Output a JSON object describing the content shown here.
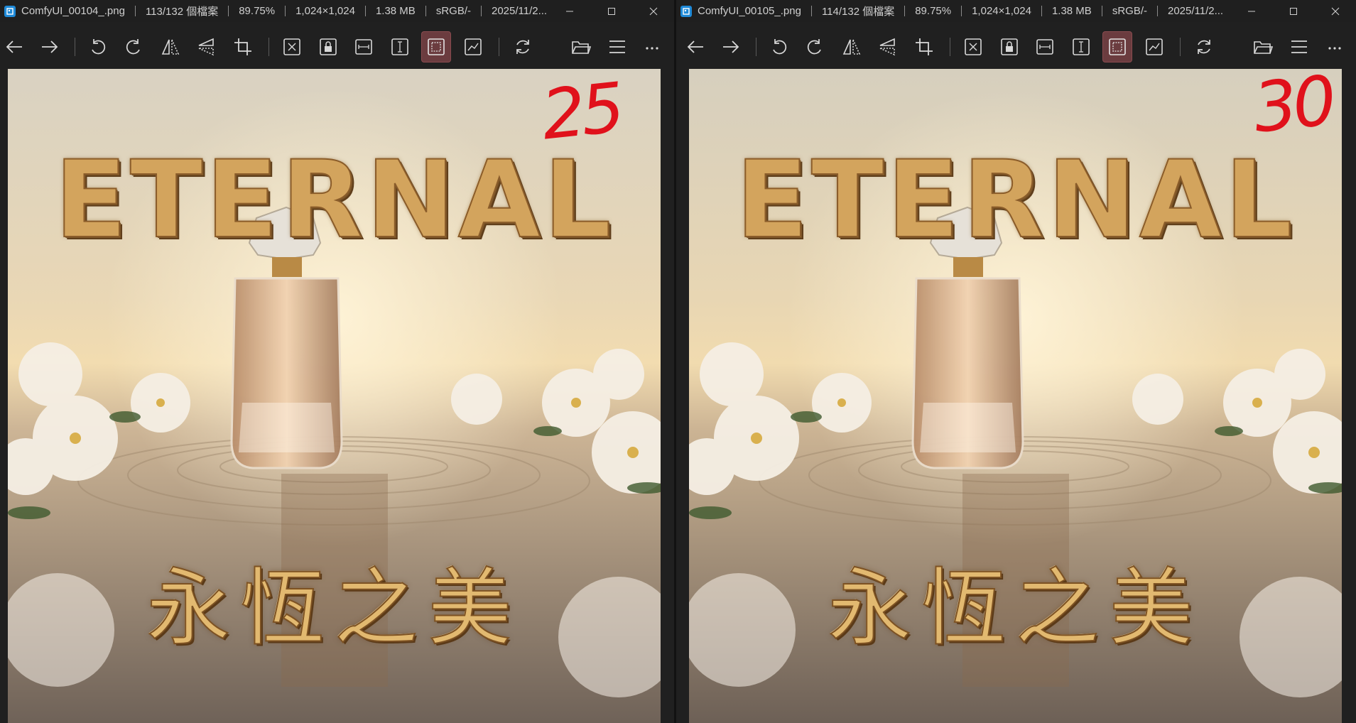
{
  "windows": [
    {
      "title": {
        "filename": "ComfyUI_00104_.png",
        "file_index": "113/132 個檔案",
        "zoom": "89.75%",
        "dimensions": "1,024×1,024",
        "file_size": "1.38 MB",
        "color_profile": "sRGB/-",
        "date": "2025/11/2..."
      },
      "image": {
        "english_text": "ETERNAL",
        "chinese_text": "永恆之美",
        "annotation": "25"
      }
    },
    {
      "title": {
        "filename": "ComfyUI_00105_.png",
        "file_index": "114/132 個檔案",
        "zoom": "89.75%",
        "dimensions": "1,024×1,024",
        "file_size": "1.38 MB",
        "color_profile": "sRGB/-",
        "date": "2025/11/2..."
      },
      "image": {
        "english_text": "ETERNAL",
        "chinese_text": "永恆之美",
        "annotation": "30"
      }
    }
  ],
  "toolbar": {
    "buttons": [
      "back-arrow-icon",
      "forward-arrow-icon",
      "rotate-left-icon",
      "rotate-right-icon",
      "flip-horizontal-icon",
      "flip-vertical-icon",
      "crop-icon",
      "fit-window-icon",
      "lock-zoom-icon",
      "fit-width-icon",
      "fit-height-icon",
      "scale-actual-icon",
      "histogram-icon",
      "refresh-icon",
      "open-folder-icon",
      "menu-icon",
      "more-icon"
    ],
    "active_button": "scale-actual-icon"
  },
  "colors": {
    "titlebar_bg": "#1f1f1f",
    "toolbar_bg": "#202020",
    "active_button_bg": "#6b3c3f",
    "annotation_red": "#e0111b",
    "gold_text": "#d3a45d"
  }
}
